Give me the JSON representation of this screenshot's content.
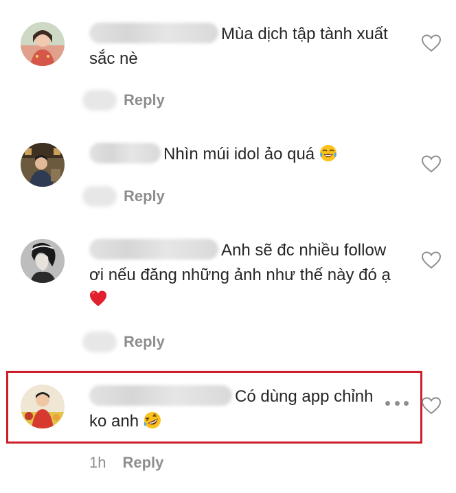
{
  "comments": [
    {
      "text": "Mùa dịch tập tành xuất sắc nè",
      "reply_label": "Reply",
      "time": "",
      "emoji": ""
    },
    {
      "text": "Nhìn múi idol ảo quá",
      "reply_label": "Reply",
      "time": "",
      "emoji": "laughing-tears"
    },
    {
      "text": "Anh sẽ đc nhiều follow ơi nếu đăng những ảnh như thế này đó ạ",
      "reply_label": "Reply",
      "time": "",
      "emoji": "red-heart"
    },
    {
      "text": "Có dùng app chỉnh ko anh",
      "reply_label": "Reply",
      "time": "1h",
      "emoji": "rolling-laughing"
    }
  ],
  "colors": {
    "highlight": "#cc1d2a",
    "meta_text": "#8e8e8e",
    "body_text": "#262626"
  },
  "icons": {
    "like": "heart-outline-icon",
    "more": "more-options-icon"
  }
}
